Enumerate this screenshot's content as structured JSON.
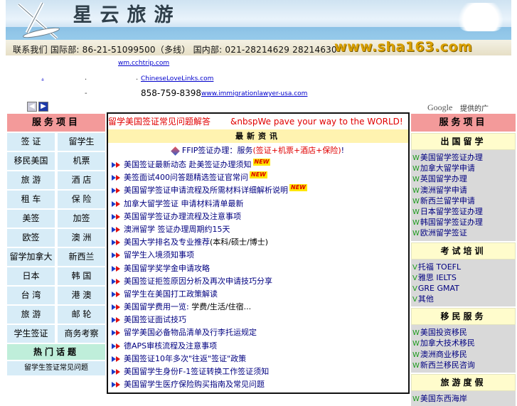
{
  "banner": {
    "logo_chars": [
      "星",
      "云",
      "旅",
      "游"
    ],
    "contact": "联系我们  国际部: 86-21-51099500（多线）  国内部: 021-28214629 28214630",
    "site_url": "www.sha163.com"
  },
  "ads": {
    "link1": "wm.cchtrip.com",
    "link2": "ChineseLoveLinks.com",
    "phone": "858-759-8398",
    "link3": "www.immigrationlawyer-usa.com",
    "google_mark": "Google",
    "google_label": "提供的广告",
    "prev_icon": "left-arrow-icon",
    "next_icon": "right-arrow-icon"
  },
  "left": {
    "header": "服务项目",
    "items": [
      "签 证",
      "留学生",
      "移民美国",
      "机票",
      "旅 游",
      "酒 店",
      "租 车",
      "保 险",
      "美签",
      "加签",
      "欧签",
      "澳 洲",
      "留学加拿大",
      "新西兰",
      "日本",
      "韩 国",
      "台 湾",
      "港 澳",
      "旅 游",
      "邮 轮",
      "学生签证",
      "商务考察"
    ],
    "header2": "热门话题",
    "sub": "留学生签证常见问题"
  },
  "center": {
    "marquee_cn": "留学美国签证常见问题解答",
    "marquee_en": "&nbspWe pave your way to the WORLD!",
    "header": "最新资讯",
    "featured_prefix": "FFIP签证办理：",
    "featured_mid": "服务",
    "featured_red": "(签证+机票+酒店+保险)",
    "featured_suffix": "!",
    "news": [
      {
        "text": "美国签证最新动态 赴美签证办理须知",
        "new": true,
        "extra": ""
      },
      {
        "text": "美签面试400问答题精选签证官常问",
        "new": true,
        "extra": ""
      },
      {
        "text": "美国留学签证申请流程及所需材料详细解析说明",
        "new": true,
        "extra": ""
      },
      {
        "text": "加拿大留学签证 申请材料清单最新",
        "new": false,
        "extra": ""
      },
      {
        "text": "英国留学签证办理流程及注意事项",
        "new": false,
        "extra": ""
      },
      {
        "text": "澳洲留学 签证办理周期约15天",
        "new": false,
        "extra": ""
      },
      {
        "text": "美国大学排名及专业推荐",
        "new": false,
        "extra": "(本科/硕士/博士)"
      },
      {
        "text": "留学生入境须知事项",
        "new": false,
        "extra": ""
      },
      {
        "text": "美国留学奖学金申请攻略",
        "new": false,
        "extra": ""
      },
      {
        "text": "美国签证拒签原因分析及再次申请技巧分享",
        "new": false,
        "extra": ""
      },
      {
        "text": "留学生在美国打工政策解读",
        "new": false,
        "extra": ""
      },
      {
        "text": "美国留学费用一览: ",
        "new": false,
        "extra": "学费/生活/住宿..."
      },
      {
        "text": "美国签证面试技巧",
        "new": false,
        "extra": ""
      },
      {
        "text": "留学美国必备物品清单及行李托运规定",
        "new": false,
        "extra": ""
      },
      {
        "text": "德APS审核流程及注意事项",
        "new": false,
        "extra": ""
      },
      {
        "text": "美国签证10年多次\"往返\"签证\"政策",
        "new": false,
        "extra": ""
      },
      {
        "text": "美国留学生身份F-1签证转换工作签证须知",
        "new": false,
        "extra": ""
      },
      {
        "text": "美国留学生医疗保险购买指南及常见问题",
        "new": false,
        "extra": ""
      }
    ]
  },
  "right": {
    "header": "服务项目",
    "sections": [
      {
        "title": "出国留学",
        "items": [
          "美国留学签证办理",
          "加拿大留学申请",
          "英国留学办理",
          "澳洲留学申请",
          "新西兰留学申请",
          "日本留学签证办理",
          "韩国留学签证办理",
          "欧洲留学签证"
        ]
      },
      {
        "title": "考试培训",
        "items": [
          "托福 TOEFL",
          "雅思 IELTS",
          "GRE  GMAT",
          "其他"
        ]
      },
      {
        "title": "移民服务",
        "items": [
          "美国投资移民",
          "加拿大技术移民",
          "澳洲商业移民",
          "新西兰移民咨询"
        ]
      },
      {
        "title": "旅游度假",
        "items": [
          "美国东西海岸"
        ]
      }
    ]
  }
}
